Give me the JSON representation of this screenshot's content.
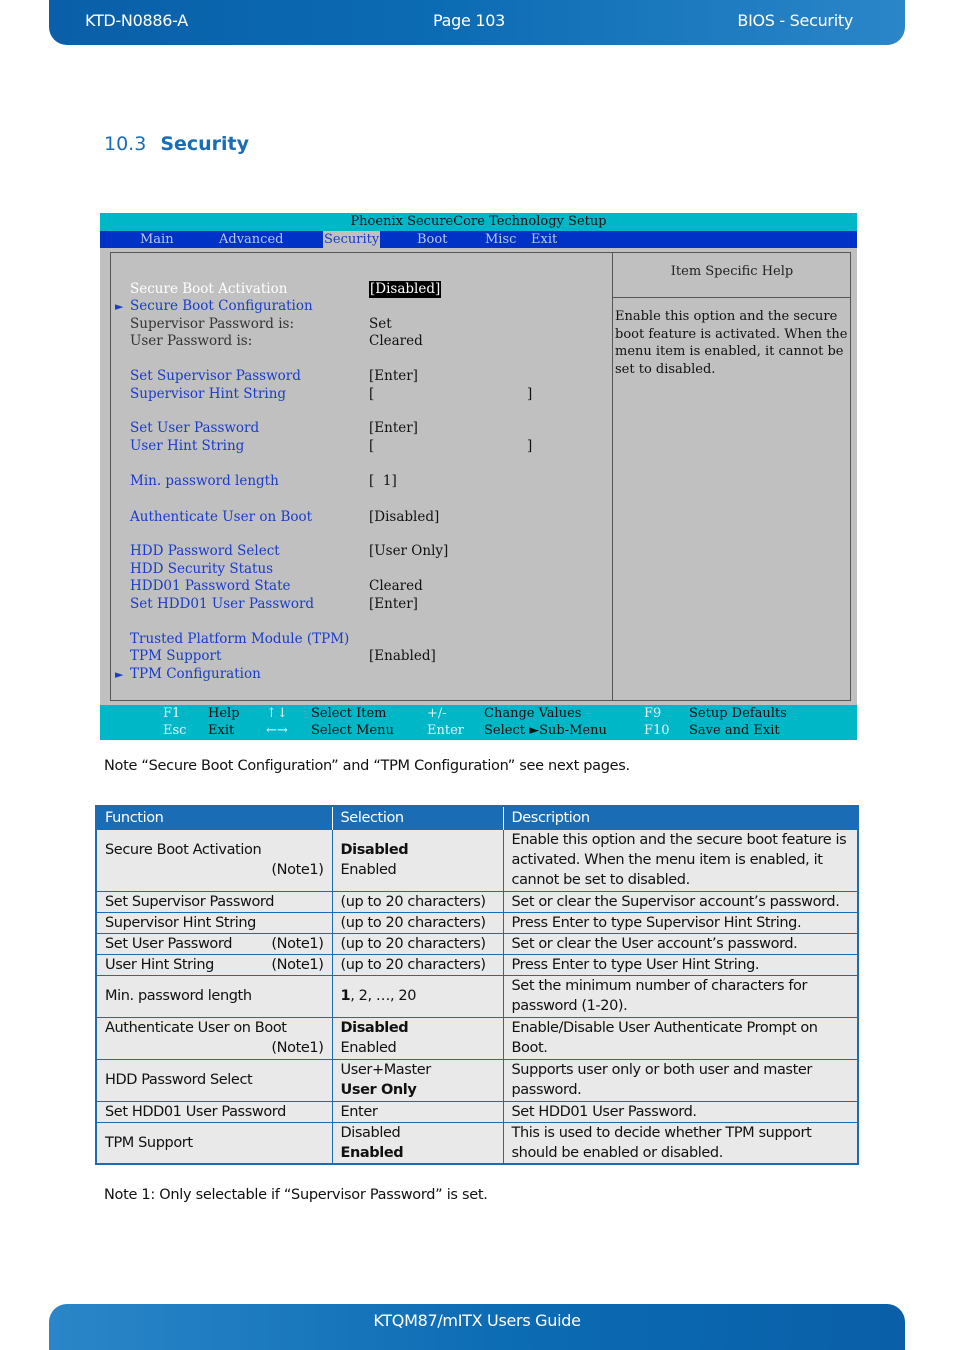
{
  "header": {
    "doc_id": "KTD-N0886-A",
    "page": "Page 103",
    "chapter": "BIOS  - Security"
  },
  "section": {
    "number": "10.3",
    "title": "Security"
  },
  "bios": {
    "title": "Phoenix SecureCore Technology Setup",
    "menu": [
      "Main",
      "Advanced",
      "Security",
      "Boot",
      "Misc",
      "Exit"
    ],
    "active_menu": "Security",
    "help_title": "Item Specific Help",
    "help_text": "Enable this option and the secure boot feature is activated. When the menu item is enabled, it cannot be set to disabled.",
    "items": [
      {
        "label": "Secure Boot Activation",
        "value": "[Disabled]"
      },
      {
        "label": "Secure Boot Configuration",
        "value": ""
      },
      {
        "label": "Supervisor Password is:",
        "value": "Set"
      },
      {
        "label": "User Password is:",
        "value": "Cleared"
      },
      {
        "label": "Set Supervisor Password",
        "value": "[Enter]"
      },
      {
        "label": "Supervisor Hint String",
        "value": "[",
        "value_end": "]"
      },
      {
        "label": "Set User Password",
        "value": "[Enter]"
      },
      {
        "label": "User Hint String",
        "value": "[",
        "value_end": "]"
      },
      {
        "label": "Min. password length",
        "value": "[  1]"
      },
      {
        "label": "Authenticate User on Boot",
        "value": "[Disabled]"
      },
      {
        "label": "HDD Password Select",
        "value": "[User Only]"
      },
      {
        "label": "HDD Security Status",
        "value": ""
      },
      {
        "label": "HDD01 Password State",
        "value": "Cleared"
      },
      {
        "label": "Set HDD01 User Password",
        "value": "[Enter]"
      },
      {
        "label": "Trusted Platform Module (TPM)",
        "value": ""
      },
      {
        "label": "TPM Support",
        "value": "[Enabled]"
      },
      {
        "label": "TPM Configuration",
        "value": ""
      }
    ],
    "submenu_arrow": "►",
    "footer": [
      {
        "key": "F1",
        "desc": "Help"
      },
      {
        "key": "Esc",
        "desc": "Exit"
      },
      {
        "key": "↑↓",
        "desc": "Select Item"
      },
      {
        "key": "←→",
        "desc": "Select Menu"
      },
      {
        "key": "+/-",
        "desc": "Change Values"
      },
      {
        "key": "Enter",
        "desc": "Select ►Sub-Menu"
      },
      {
        "key": "F9",
        "desc": "Setup Defaults"
      },
      {
        "key": "F10",
        "desc": "Save and Exit"
      }
    ]
  },
  "note_top": "Note “Secure Boot Configuration” and “TPM Configuration” see next pages.",
  "table": {
    "headers": [
      "Function",
      "Selection",
      "Description"
    ],
    "rows": [
      {
        "function": "Secure Boot Activation",
        "note": "(Note1)",
        "selection": [
          "Disabled",
          "Enabled"
        ],
        "description": "Enable this option and the secure boot feature is activated. When the menu item is enabled, it cannot be set to disabled."
      },
      {
        "function": "Set Supervisor Password",
        "note": "",
        "selection": [
          "(up to 20 characters)"
        ],
        "description": "Set or clear the Supervisor account’s password."
      },
      {
        "function": "Supervisor Hint String",
        "note": "",
        "selection": [
          "(up to 20 characters)"
        ],
        "description": "Press Enter to type Supervisor Hint String."
      },
      {
        "function": "Set User Password",
        "note": "(Note1)",
        "selection": [
          "(up to 20 characters)"
        ],
        "description": "Set or clear the User account’s password."
      },
      {
        "function": "User Hint String",
        "note": "(Note1)",
        "selection": [
          "(up to 20 characters)"
        ],
        "description": "Press Enter to type User Hint String."
      },
      {
        "function": "Min. password length",
        "note": "",
        "selection_bold": "1",
        "selection_rest": ", 2, …, 20",
        "description": "Set the minimum number of characters for password (1-20)."
      },
      {
        "function": "Authenticate User on Boot",
        "note": "(Note1)",
        "selection": [
          "Disabled",
          "Enabled"
        ],
        "description": "Enable/Disable User Authenticate Prompt on Boot."
      },
      {
        "function": "HDD Password Select",
        "note": "",
        "selection": [
          "User+Master",
          "User Only"
        ],
        "description": "Supports user only or both user and master password."
      },
      {
        "function": "Set HDD01 User Password",
        "note": "",
        "selection": [
          "Enter"
        ],
        "description": "Set HDD01 User Password."
      },
      {
        "function": "TPM Support",
        "note": "",
        "selection": [
          "Disabled",
          "Enabled"
        ],
        "description": "This is used to decide whether TPM support should be enabled or disabled."
      }
    ]
  },
  "note_bottom": "Note 1: Only selectable if “Supervisor Password” is set.",
  "footer": {
    "title": "KTQM87/mITX Users Guide"
  }
}
